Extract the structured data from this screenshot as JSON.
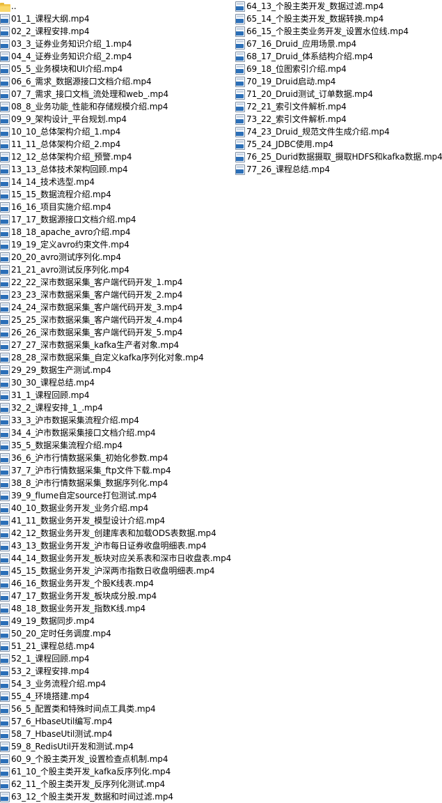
{
  "parent_folder": {
    "label": "..",
    "icon": "folder-icon"
  },
  "files_left": [
    "01_1_课程大纲.mp4",
    "02_2_课程安排.mp4",
    "03_3_证券业务知识介绍_1.mp4",
    "04_4_证券业务知识介绍_2.mp4",
    "05_5_业务模块和UI介绍.mp4",
    "06_6_需求_数据源接口文档介绍.mp4",
    "07_7_需求_接口文档_流处理和web_.mp4",
    "08_8_业务功能_性能和存储规模介绍.mp4",
    "09_9_架构设计_平台规划.mp4",
    "10_10_总体架构介绍_1.mp4",
    "11_11_总体架构介绍_2.mp4",
    "12_12_总体架构介绍_预警.mp4",
    "13_13_总体技术架构回顾.mp4",
    "14_14_技术选型.mp4",
    "15_15_数据流程介绍.mp4",
    "16_16_项目实施介绍.mp4",
    "17_17_数据源接口文档介绍.mp4",
    "18_18_apache_avro介绍.mp4",
    "19_19_定义avro约束文件.mp4",
    "20_20_avro测试序列化.mp4",
    "21_21_avro测试反序列化.mp4",
    "22_22_深市数据采集_客户端代码开发_1.mp4",
    "23_23_深市数据采集_客户端代码开发_2.mp4",
    "24_24_深市数据采集_客户端代码开发_3.mp4",
    "25_25_深市数据采集_客户端代码开发_4.mp4",
    "26_26_深市数据采集_客户端代码开发_5.mp4",
    "27_27_深市数据采集_kafka生产者对象.mp4",
    "28_28_深市数据采集_自定义kafka序列化对象.mp4",
    "29_29_数据生产测试.mp4",
    "30_30_课程总结.mp4",
    "31_1_课程回顾.mp4",
    "32_2_课程安排_1_.mp4",
    "33_3_沪市数据采集流程介绍.mp4",
    "34_4_沪市数据采集接口文档介绍.mp4",
    "35_5_数据采集流程介绍.mp4",
    "36_6_沪市行情数据采集_初始化参数.mp4",
    "37_7_沪市行情数据采集_ftp文件下载.mp4",
    "38_8_沪市行情数据采集_数据序列化.mp4",
    "39_9_flume自定source打包测试.mp4",
    "40_10_数据业务开发_业务介绍.mp4",
    "41_11_数据业务开发_模型设计介绍.mp4",
    "42_12_数据业务开发_创建库表和加载ODS表数据.mp4",
    "43_13_数据业务开发_沪市每日证券收盘明细表.mp4",
    "44_14_数据业务开发_板块对应关系表和深市日收盘表.mp4",
    "45_15_数据业务开发_沪深两市指数日收盘明细表.mp4",
    "46_16_数据业务开发_个股K线表.mp4",
    "47_17_数据业务开发_板块成分股.mp4",
    "48_18_数据业务开发_指数K线.mp4",
    "49_19_数据同步.mp4",
    "50_20_定时任务调度.mp4",
    "51_21_课程总结.mp4",
    "52_1_课程回顾.mp4",
    "53_2_课程安排.mp4",
    "54_3_业务流程介绍.mp4",
    "55_4_环境搭建.mp4",
    "56_5_配置类和特殊时间点工具类.mp4",
    "57_6_HbaseUtil编写.mp4",
    "58_7_HbaseUtil测试.mp4",
    "59_8_RedisUtil开发和测试.mp4",
    "60_9_个股主类开发_设置检查点机制.mp4",
    "61_10_个股主类开发_kafka反序列化.mp4",
    "62_11_个股主类开发_反序列化测试.mp4",
    "63_12_个股主类开发_数据和时间过滤.mp4"
  ],
  "files_right": [
    "64_13_个股主类开发_数据过滤.mp4",
    "65_14_个股主类开发_数据转换.mp4",
    "66_15_个股主类业务开发_设置水位线.mp4",
    "67_16_Druid_应用场景.mp4",
    "68_17_Druid_体系结构介绍.mp4",
    "69_18_位图索引介绍.mp4",
    "70_19_Druid启动.mp4",
    "71_20_Druid测试_订单数据.mp4",
    "72_21_索引文件解析.mp4",
    "73_22_索引文件解析.mp4",
    "74_23_Druid_规范文件生成介绍.mp4",
    "75_24_JDBC使用.mp4",
    "76_25_Durid数据摄取_摄取HDFS和kafka数据.mp4",
    "77_26_课程总结.mp4"
  ],
  "file_icon": "mp4-file-icon",
  "colors": {
    "icon_accent": "#2b6fb8",
    "folder": "#f3c74d",
    "text": "#000000",
    "background": "#ffffff"
  }
}
